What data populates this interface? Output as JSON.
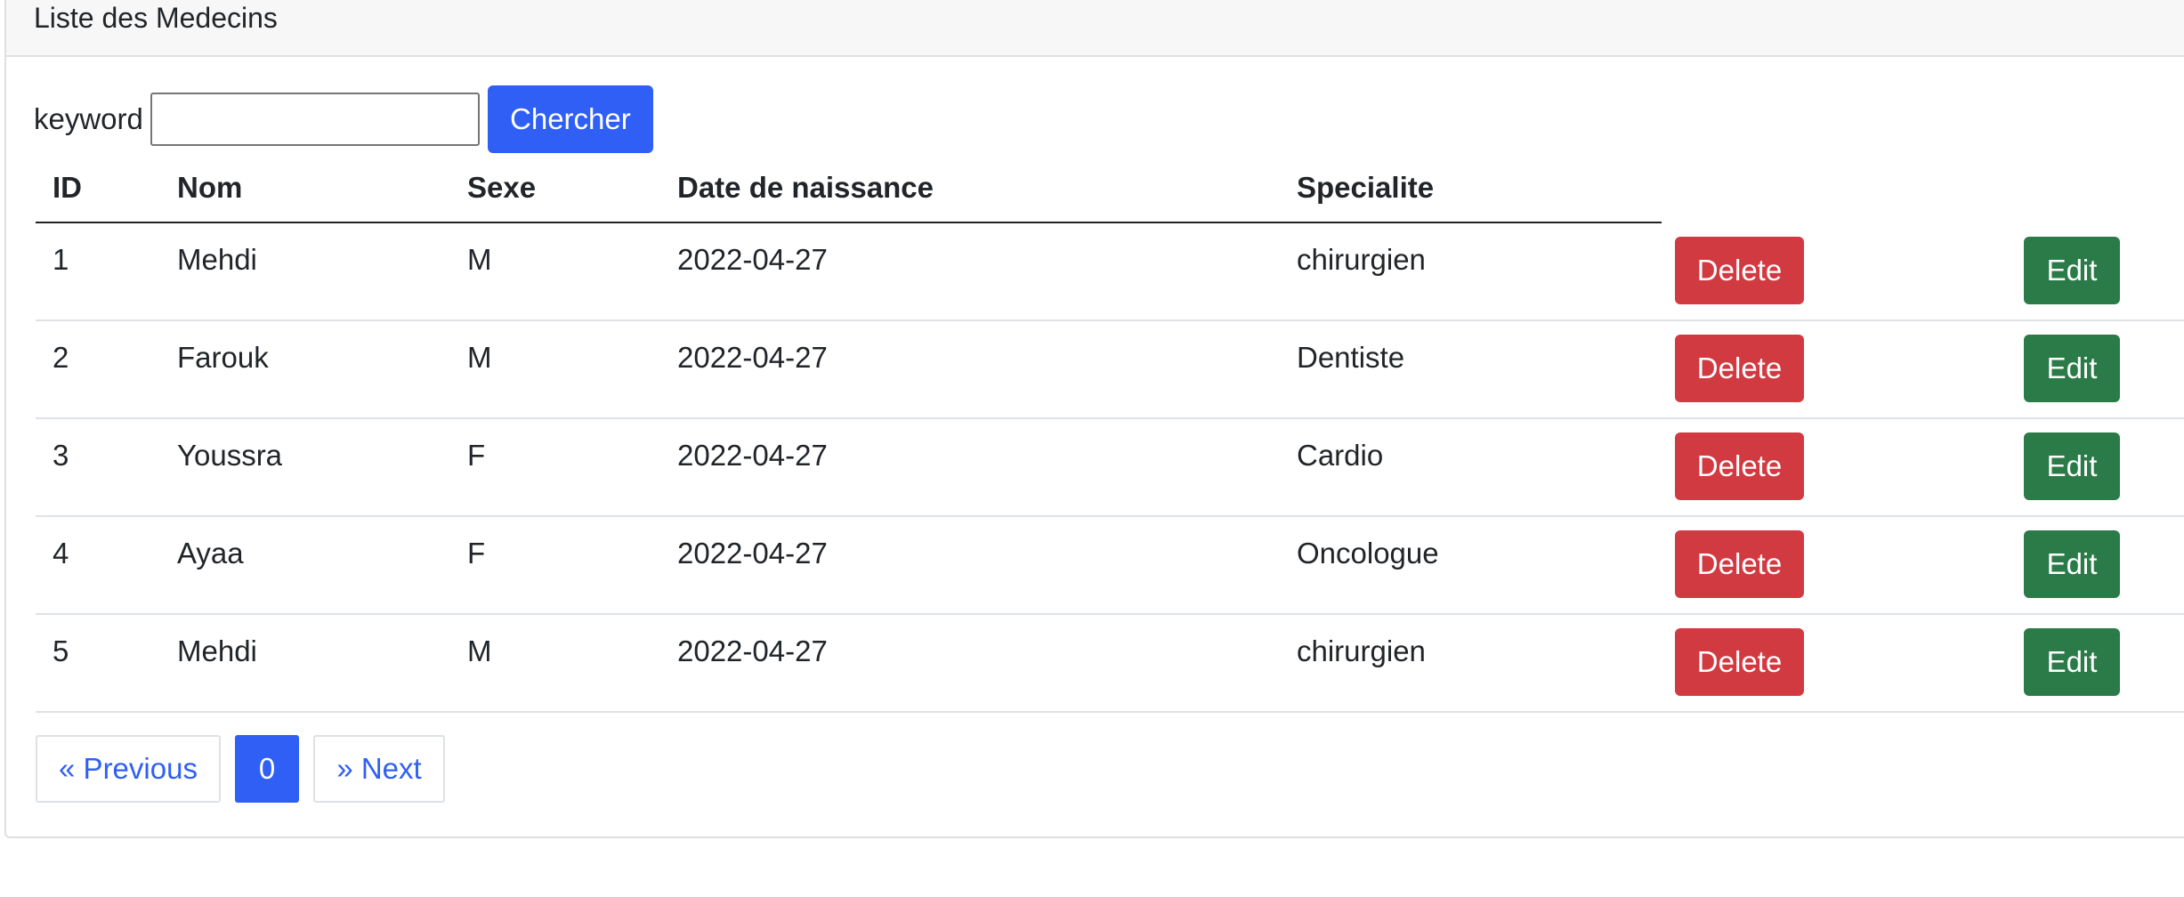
{
  "card": {
    "title": "Liste des Medecins"
  },
  "search": {
    "label": "keyword",
    "value": "",
    "placeholder": "",
    "button_label": "Chercher"
  },
  "table": {
    "headers": [
      "ID",
      "Nom",
      "Sexe",
      "Date de naissance",
      "Specialite"
    ],
    "rows": [
      {
        "id": "1",
        "nom": "Mehdi",
        "sexe": "M",
        "date": "2022-04-27",
        "specialite": "chirurgien"
      },
      {
        "id": "2",
        "nom": "Farouk",
        "sexe": "M",
        "date": "2022-04-27",
        "specialite": "Dentiste"
      },
      {
        "id": "3",
        "nom": "Youssra",
        "sexe": "F",
        "date": "2022-04-27",
        "specialite": "Cardio"
      },
      {
        "id": "4",
        "nom": "Ayaa",
        "sexe": "F",
        "date": "2022-04-27",
        "specialite": "Oncologue"
      },
      {
        "id": "5",
        "nom": "Mehdi",
        "sexe": "M",
        "date": "2022-04-27",
        "specialite": "chirurgien"
      }
    ],
    "delete_label": "Delete",
    "edit_label": "Edit"
  },
  "pagination": {
    "previous_label": "« Previous",
    "current_page": "0",
    "next_label": "» Next"
  },
  "colors": {
    "primary": "#2f5ff5",
    "danger": "#d23a41",
    "success": "#2b7b48"
  }
}
